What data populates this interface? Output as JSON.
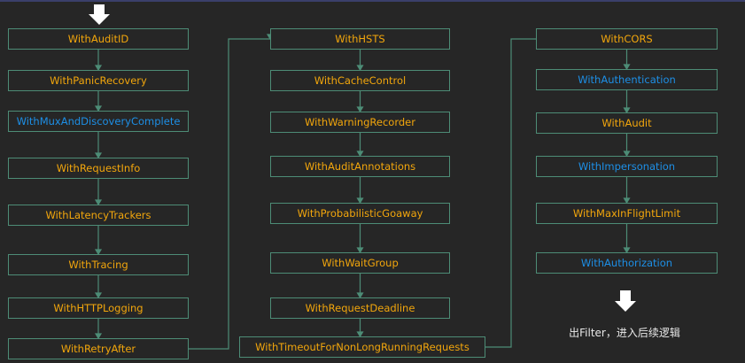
{
  "colors": {
    "background": "#262626",
    "border": "#4d8c76",
    "orange": "#f2a60c",
    "blue": "#1d8fe6"
  },
  "columns": [
    {
      "items": [
        {
          "label": "WithAuditID",
          "color": "orange"
        },
        {
          "label": "WithPanicRecovery",
          "color": "orange"
        },
        {
          "label": "WithMuxAndDiscoveryComplete",
          "color": "blue"
        },
        {
          "label": "WithRequestInfo",
          "color": "orange"
        },
        {
          "label": "WithLatencyTrackers",
          "color": "orange"
        },
        {
          "label": "WithTracing",
          "color": "orange"
        },
        {
          "label": "WithHTTPLogging",
          "color": "orange"
        },
        {
          "label": "WithRetryAfter",
          "color": "orange"
        }
      ]
    },
    {
      "items": [
        {
          "label": "WithHSTS",
          "color": "orange"
        },
        {
          "label": "WithCacheControl",
          "color": "orange"
        },
        {
          "label": "WithWarningRecorder",
          "color": "orange"
        },
        {
          "label": "WithAuditAnnotations",
          "color": "orange"
        },
        {
          "label": "WithProbabilisticGoaway",
          "color": "orange"
        },
        {
          "label": "WithWaitGroup",
          "color": "orange"
        },
        {
          "label": "WithRequestDeadline",
          "color": "orange"
        },
        {
          "label": "WithTimeoutForNonLongRunningRequests",
          "color": "orange"
        }
      ]
    },
    {
      "items": [
        {
          "label": "WithCORS",
          "color": "orange"
        },
        {
          "label": "WithAuthentication",
          "color": "blue"
        },
        {
          "label": "WithAudit",
          "color": "orange"
        },
        {
          "label": "WithImpersonation",
          "color": "blue"
        },
        {
          "label": "WithMaxInFlightLimit",
          "color": "orange"
        },
        {
          "label": "WithAuthorization",
          "color": "blue"
        }
      ]
    }
  ],
  "footer": {
    "note": "出Filter，进入后续逻辑",
    "icon": "arrow-down-icon"
  }
}
